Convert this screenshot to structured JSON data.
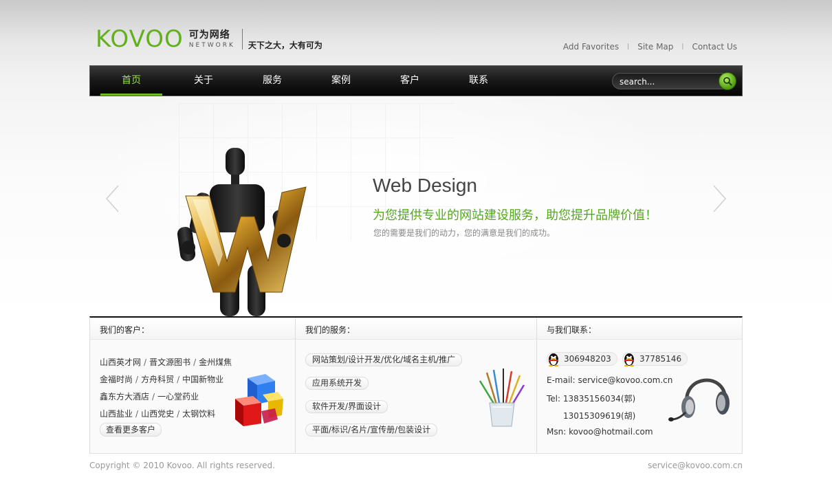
{
  "header": {
    "logo_word": "KOVOO",
    "logo_cn": "可为网络",
    "logo_en": "NETWORK",
    "slogan": "天下之大，大有可为",
    "links": [
      "Add Favorites",
      "Site Map",
      "Contact Us"
    ]
  },
  "nav": {
    "items": [
      "首页",
      "关于",
      "服务",
      "案例",
      "客户",
      "联系"
    ],
    "active_index": 0,
    "search_placeholder": "search..."
  },
  "banner": {
    "title": "Web Design",
    "subtitle": "为您提供专业的网站建设服务，助您提升品牌价值！",
    "desc": "您的需要是我们的动力，您的满意是我们的成功。"
  },
  "clients": {
    "title": "我们的客户：",
    "rows": [
      [
        "山西英才网",
        "晋文源图书",
        "金州煤焦"
      ],
      [
        "金福时尚",
        "方舟科贸",
        "中国新物业"
      ],
      [
        "鑫东方大酒店",
        "一心堂药业"
      ],
      [
        "山西盐业",
        "山西党史",
        "太钢饮料"
      ]
    ],
    "more": "查看更多客户"
  },
  "services": {
    "title": "我们的服务：",
    "items": [
      "网站策划/设计开发/优化/域名主机/推广",
      "应用系统开发",
      "软件开发/界面设计",
      "平面/标识/名片/宣传册/包装设计"
    ]
  },
  "contact": {
    "title": "与我们联系：",
    "qq": [
      "306948203",
      "37785146"
    ],
    "email": "E-mail: service@kovoo.com.cn",
    "tel1": "Tel: 13835156034(郭)",
    "tel2": "13015309619(胡)",
    "msn": "Msn: kovoo@hotmail.com"
  },
  "footer": {
    "copyright": "Copyright © 2010 Kovoo. All rights reserved.",
    "email": "service@kovoo.com.cn"
  },
  "colors": {
    "accent_green": "#62b01e",
    "nav_bg": "#111111"
  }
}
